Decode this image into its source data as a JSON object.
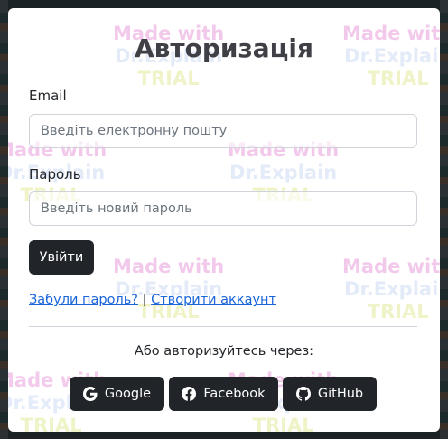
{
  "page": {
    "title": "Авторизація",
    "email_label": "Email",
    "email_placeholder": "Введіть електронну пошту",
    "password_label": "Пароль",
    "password_placeholder": "Введіть новий пароль",
    "login_button": "Увійти",
    "forgot_link": "Забули пароль?",
    "separator": "|",
    "create_link": "Створити аккаунт",
    "alt_text": "Або авторизуйтесь через:",
    "social": [
      {
        "label": "Google",
        "icon": "google-icon"
      },
      {
        "label": "Facebook",
        "icon": "facebook-icon"
      },
      {
        "label": "GitHub",
        "icon": "github-icon"
      }
    ]
  },
  "watermark": {
    "line1": "Made with",
    "line2": "Dr.Explain",
    "line3": "TRIAL"
  },
  "colors": {
    "dark": "#212529",
    "link": "#1a66d9",
    "title": "#3f3f46"
  }
}
